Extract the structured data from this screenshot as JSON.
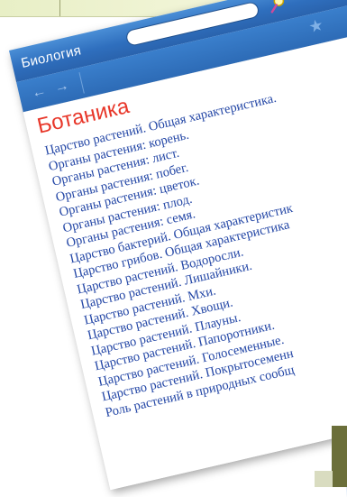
{
  "window": {
    "title": "Биология",
    "search_placeholder": "",
    "icons": {
      "back": "back-arrow-icon",
      "forward": "forward-arrow-icon",
      "search": "search-icon",
      "favorite": "star-icon"
    }
  },
  "page": {
    "title": "Ботаника",
    "topics": [
      "Царство растений. Общая характеристика.",
      "Органы растения: корень.",
      "Органы растения: лист.",
      "Органы растения: побег.",
      "Органы растения: цветок.",
      "Органы растения: плод.",
      "Органы растения: семя.",
      "Царство бактерий. Общая характеристик",
      "Царство грибов. Общая характеристика",
      "Царство растений. Водоросли.",
      "Царство растений. Лишайники.",
      "Царство растений. Мхи.",
      "Царство растений. Хвощи.",
      "Царство растений. Плауны.",
      "Царство растений. Папоротники.",
      "Царство растений. Голосеменные.",
      "Царство растений. Покрытосеменн",
      "Роль растений в природных сообщ"
    ]
  },
  "colors": {
    "title_bar": "#2f6fbe",
    "page_title": "#e8372a",
    "link_text": "#2447a6"
  }
}
